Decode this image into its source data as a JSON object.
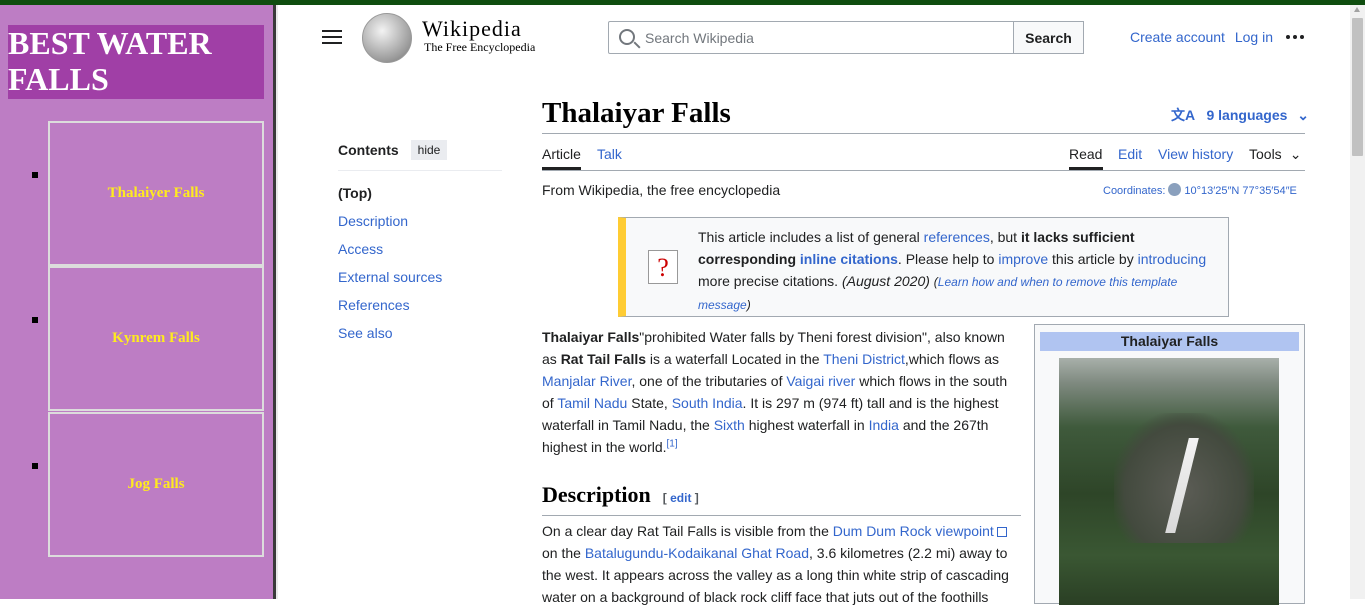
{
  "sidebar": {
    "title": "BEST WATER FALLS",
    "items": [
      {
        "label": "Thalaiyer Falls"
      },
      {
        "label": "Kynrem Falls"
      },
      {
        "label": "Jog Falls"
      }
    ]
  },
  "header": {
    "logo_word": "Wikipedia",
    "logo_tagline": "The Free Encyclopedia",
    "search_placeholder": "Search Wikipedia",
    "search_button": "Search",
    "create_account": "Create account",
    "log_in": "Log in"
  },
  "toc": {
    "heading": "Contents",
    "hide_label": "hide",
    "items": [
      "(Top)",
      "Description",
      "Access",
      "External sources",
      "References",
      "See also"
    ]
  },
  "article": {
    "title": "Thalaiyar Falls",
    "languages": "9 languages",
    "tabs_left": [
      "Article",
      "Talk"
    ],
    "tabs_right": [
      "Read",
      "Edit",
      "View history",
      "Tools"
    ],
    "from_line": "From Wikipedia, the free encyclopedia",
    "coords_label": "Coordinates:",
    "coords_value": "10°13′25″N 77°35′54″E",
    "notice": {
      "t1": "This article includes a list of general ",
      "l1": "references",
      "t2": ", but ",
      "b1": "it lacks sufficient corresponding ",
      "l2": "inline citations",
      "t3": ". Please help to ",
      "l3": "improve",
      "t4": " this article by ",
      "l4": "introducing",
      "t5": " more precise citations. ",
      "date": "(August 2020)",
      "learn": "Learn how and when to remove this template message"
    },
    "intro": {
      "b1": "Thalaiyar Falls",
      "t1": "\"prohibited Water falls by Theni forest division\", also known as ",
      "b2": "Rat Tail Falls",
      "t2": " is a waterfall Located in the ",
      "l1": "Theni District",
      "t3": ",which flows as ",
      "l2": "Manjalar River",
      "t4": ", one of the tributaries of ",
      "l3": "Vaigai river",
      "t5": " which flows in the south of ",
      "l4": "Tamil Nadu",
      "t6": " State, ",
      "l5": "South India",
      "t7": ". It is 297 m (974 ft) tall and is the highest waterfall in Tamil Nadu, the ",
      "l6": "Sixth",
      "t8": " highest waterfall in ",
      "l7": "India",
      "t9": " and the 267th highest in the world.",
      "ref": "[1]"
    },
    "section_heading": "Description",
    "edit_label": "edit",
    "desc": {
      "t1": "On a clear day Rat Tail Falls is visible from the ",
      "l1": "Dum Dum Rock viewpoint",
      "t2": " on the ",
      "l2": "Batalugundu-Kodaikanal Ghat Road",
      "t3": ", 3.6 kilometres (2.2 mi) away to the west. It appears across the valley as a long thin white strip of cascading water on a background of black rock cliff face that juts out of the foothills"
    },
    "infobox_title": "Thalaiyar Falls"
  }
}
